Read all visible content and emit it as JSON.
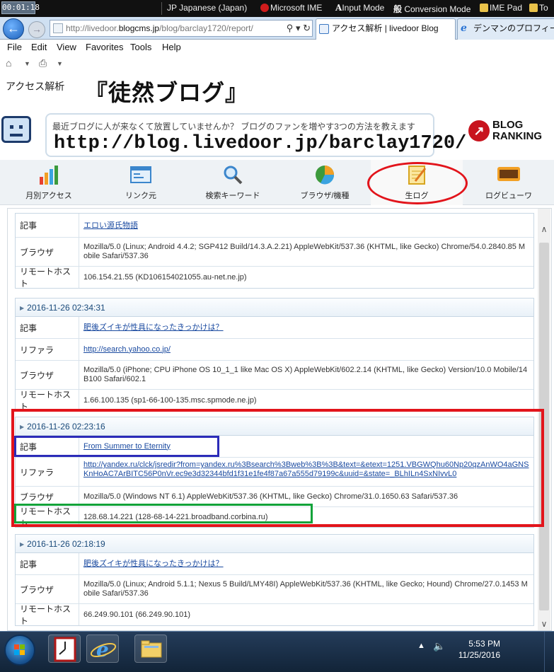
{
  "langbar": {
    "timer": "00:01:18",
    "language": "JP Japanese (Japan)",
    "ime": "Microsoft IME",
    "input_mode": "Input Mode",
    "conversion_mode": "Conversion Mode",
    "ime_pad": "IME Pad",
    "tools": "To"
  },
  "browser": {
    "address_prefix": "http://livedoor.",
    "address_host": "blogcms.jp",
    "address_path": "/blog/barclay1720/report/",
    "tab_active": "アクセス解析 | livedoor Blog",
    "tab_2": "デンマンのプロフィール",
    "menu": [
      "File",
      "Edit",
      "View",
      "Favorites",
      "Tools",
      "Help"
    ]
  },
  "header": {
    "access_title": "アクセス解析",
    "blog_title": "『徒然ブログ』"
  },
  "promo": {
    "text": "最近ブログに人が来なくて放置していませんか？ ブログのファンを増やす3つの方法を教えます",
    "url": "http://blog.livedoor.jp/barclay1720/",
    "ranking_line1": "BLOG",
    "ranking_line2": "RANKING"
  },
  "navtabs": [
    {
      "label": "月別アクセス"
    },
    {
      "label": "リンク元"
    },
    {
      "label": "検索キーワード"
    },
    {
      "label": "ブラウザ/機種"
    },
    {
      "label": "生ログ"
    },
    {
      "label": "ログビューワ"
    }
  ],
  "logs": [
    {
      "datetime": "",
      "rows": [
        {
          "key": "記事",
          "value": "エロい源氏物語",
          "link": true
        },
        {
          "key": "ブラウザ",
          "value": "Mozilla/5.0 (Linux; Android 4.4.2; SGP412 Build/14.3.A.2.21) AppleWebKit/537.36 (KHTML, like Gecko) Chrome/54.0.2840.85 Mobile Safari/537.36",
          "link": false
        },
        {
          "key": "リモートホスト",
          "value": "106.154.21.55 (KD106154021055.au-net.ne.jp)",
          "link": false
        }
      ]
    },
    {
      "datetime": "2016-11-26 02:34:31",
      "rows": [
        {
          "key": "記事",
          "value": "肥後ズイキが性具になったきっかけは？",
          "link": true
        },
        {
          "key": "リファラ",
          "value": "http://search.yahoo.co.jp/",
          "link": true
        },
        {
          "key": "ブラウザ",
          "value": "Mozilla/5.0 (iPhone; CPU iPhone OS 10_1_1 like Mac OS X) AppleWebKit/602.2.14 (KHTML, like Gecko) Version/10.0 Mobile/14B100 Safari/602.1",
          "link": false
        },
        {
          "key": "リモートホスト",
          "value": "1.66.100.135 (sp1-66-100-135.msc.spmode.ne.jp)",
          "link": false
        }
      ]
    },
    {
      "datetime": "2016-11-26 02:23:16",
      "rows": [
        {
          "key": "記事",
          "value": "From Summer to Eternity",
          "link": true
        },
        {
          "key": "リファラ",
          "value": "http://yandex.ru/clck/jsredir?from=yandex.ru%3Bsearch%3Bweb%3B%3B&text=&etext=1251.VBGWQhu60Np20qzAnWO4aGNSKnHoAC7ArBITC56P0nVr.ec9e3d32344bfd1f31e1fe4f87a67a555d79199c&uuid=&state=_BLhILn4SxNIvvL0",
          "link": true
        },
        {
          "key": "ブラウザ",
          "value": "Mozilla/5.0 (Windows NT 6.1) AppleWebKit/537.36 (KHTML, like Gecko) Chrome/31.0.1650.63 Safari/537.36",
          "link": false
        },
        {
          "key": "リモートホスト",
          "value": "128.68.14.221 (128-68-14-221.broadband.corbina.ru)",
          "link": false
        }
      ]
    },
    {
      "datetime": "2016-11-26 02:18:19",
      "rows": [
        {
          "key": "記事",
          "value": "肥後ズイキが性具になったきっかけは？",
          "link": true
        },
        {
          "key": "ブラウザ",
          "value": "Mozilla/5.0 (Linux; Android 5.1.1; Nexus 5 Build/LMY48I) AppleWebKit/537.36 (KHTML, like Gecko; Hound) Chrome/27.0.1453 Mobile Safari/537.36",
          "link": false
        },
        {
          "key": "リモートホスト",
          "value": "66.249.90.101 (66.249.90.101)",
          "link": false
        }
      ]
    }
  ],
  "taskbar": {
    "time": "5:53 PM",
    "date": "11/25/2016"
  }
}
